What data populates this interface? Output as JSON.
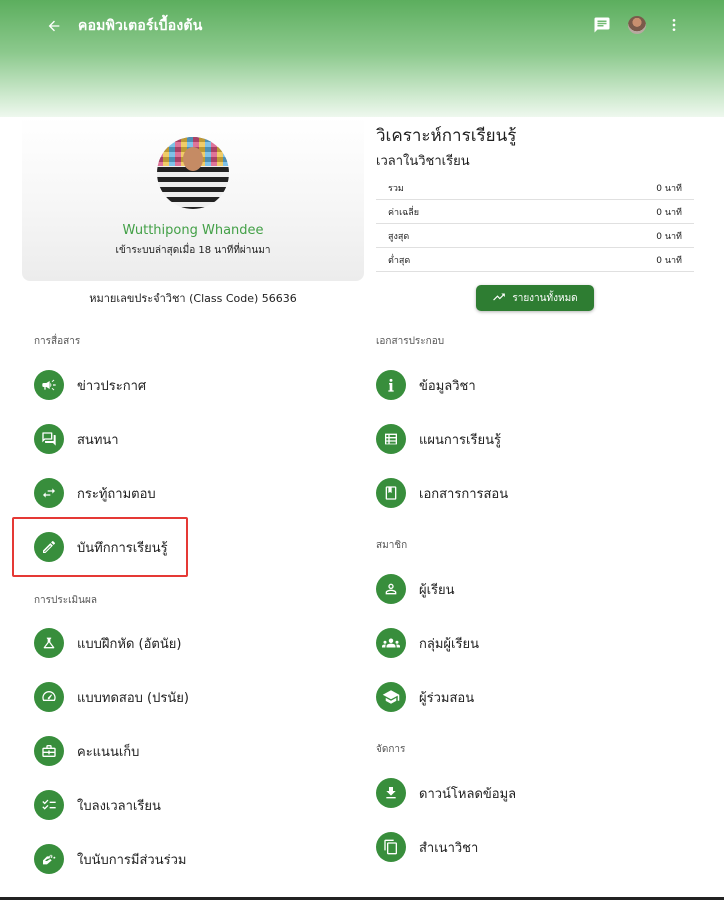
{
  "app": {
    "title": "คอมพิวเตอร์เบื้องต้น"
  },
  "profile": {
    "name": "Wutthipong Whandee",
    "last_seen": "เข้าระบบล่าสุดเมื่อ 18 นาทีที่ผ่านมา",
    "class_code": "หมายเลขประจำวิชา (Class Code) 56636"
  },
  "analytics": {
    "title": "วิเคราะห์การเรียนรู้",
    "subtitle": "เวลาในวิชาเรียน",
    "rows": [
      {
        "label": "รวม",
        "value": "0 นาที"
      },
      {
        "label": "ค่าเฉลี่ย",
        "value": "0 นาที"
      },
      {
        "label": "สูงสุด",
        "value": "0 นาที"
      },
      {
        "label": "ต่ำสุด",
        "value": "0 นาที"
      }
    ],
    "report_button": "รายงานทั้งหมด"
  },
  "sections": {
    "communication": {
      "heading": "การสื่อสาร",
      "items": [
        {
          "label": "ข่าวประกาศ",
          "icon": "megaphone-icon"
        },
        {
          "label": "สนทนา",
          "icon": "chat-bubbles-icon"
        },
        {
          "label": "กระทู้ถามตอบ",
          "icon": "swap-arrows-icon"
        },
        {
          "label": "บันทึกการเรียนรู้",
          "icon": "pencil-icon"
        }
      ]
    },
    "assessment": {
      "heading": "การประเมินผล",
      "items": [
        {
          "label": "แบบฝึกหัด (อัตนัย)",
          "icon": "flask-icon"
        },
        {
          "label": "แบบทดสอบ (ปรนัย)",
          "icon": "speedometer-icon"
        },
        {
          "label": "คะแนนเก็บ",
          "icon": "briefcase-icon"
        },
        {
          "label": "ใบลงเวลาเรียน",
          "icon": "checklist-icon"
        },
        {
          "label": "ใบนับการมีส่วนร่วม",
          "icon": "hand-stars-icon"
        }
      ]
    },
    "documents": {
      "heading": "เอกสารประกอบ",
      "items": [
        {
          "label": "ข้อมูลวิชา",
          "icon": "info-icon"
        },
        {
          "label": "แผนการเรียนรู้",
          "icon": "table-icon"
        },
        {
          "label": "เอกสารการสอน",
          "icon": "book-icon"
        }
      ]
    },
    "members": {
      "heading": "สมาชิก",
      "items": [
        {
          "label": "ผู้เรียน",
          "icon": "person-icon"
        },
        {
          "label": "กลุ่มผู้เรียน",
          "icon": "group-icon"
        },
        {
          "label": "ผู้ร่วมสอน",
          "icon": "graduation-cap-icon"
        }
      ]
    },
    "manage": {
      "heading": "จัดการ",
      "items": [
        {
          "label": "ดาวน์โหลดข้อมูล",
          "icon": "download-icon"
        },
        {
          "label": "สำเนาวิชา",
          "icon": "copy-icon"
        }
      ]
    }
  },
  "colors": {
    "primary": "#388e3c",
    "button": "#2e7d32",
    "name": "#43a047",
    "highlight": "#e53935"
  }
}
